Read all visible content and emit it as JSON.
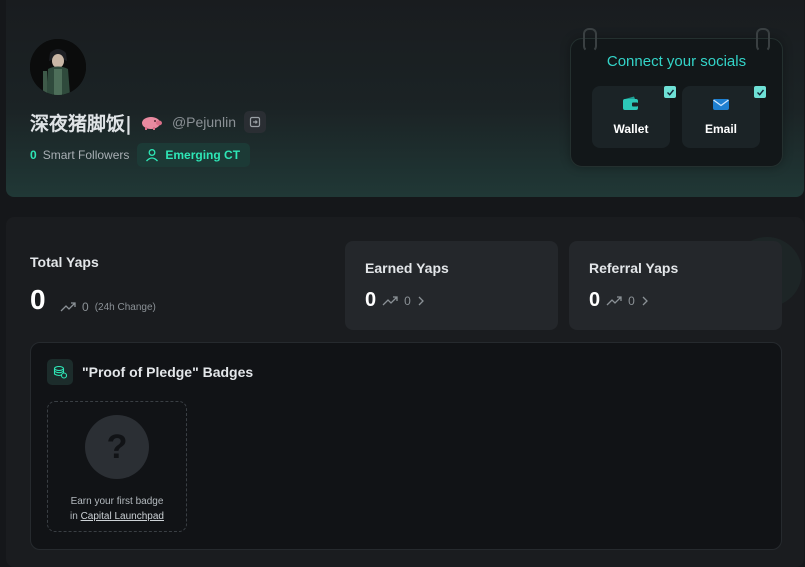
{
  "profile": {
    "display_name": "深夜猪脚饭|",
    "handle": "@Pejunlin",
    "followers_count": "0",
    "followers_label": "Smart Followers",
    "tier": "Emerging CT"
  },
  "socials": {
    "title": "Connect your socials",
    "items": [
      {
        "label": "Wallet",
        "icon": "wallet-icon"
      },
      {
        "label": "Email",
        "icon": "mail-icon"
      }
    ]
  },
  "stats": {
    "total_label": "Total Yaps",
    "total_value": "0",
    "total_change": "0",
    "total_change_note": "(24h Change)",
    "earned": {
      "label": "Earned Yaps",
      "value": "0",
      "change": "0"
    },
    "referral": {
      "label": "Referral Yaps",
      "value": "0",
      "change": "0"
    }
  },
  "badges": {
    "title": "\"Proof of Pledge\" Badges",
    "empty_line1": "Earn your first badge",
    "empty_prefix": "in ",
    "empty_link": "Capital Launchpad"
  },
  "colors": {
    "accent": "#2ee6b6",
    "socials_title": "#33d4c8",
    "background": "#15171a"
  }
}
